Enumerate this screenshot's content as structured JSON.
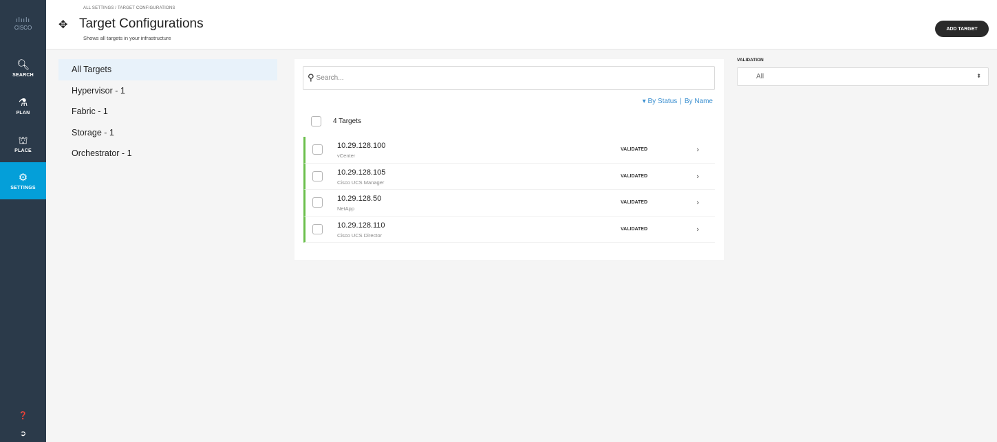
{
  "nav": {
    "logo_bars": "ılıılı",
    "logo_word": "CISCO",
    "items": [
      {
        "label": "SEARCH",
        "icon": "search-icon",
        "glyph": "🔍︎"
      },
      {
        "label": "PLAN",
        "icon": "flask-icon",
        "glyph": "⚗"
      },
      {
        "label": "PLACE",
        "icon": "place-icon",
        "glyph": "⛫"
      },
      {
        "label": "SETTINGS",
        "icon": "gears-icon",
        "glyph": "⚙"
      }
    ],
    "active_item": "SETTINGS",
    "help_glyph": "❓",
    "logout_glyph": "➲",
    "active_color": "#049fd9",
    "rail_color": "#2b3a4a"
  },
  "header": {
    "breadcrumb": "ALL SETTINGS / TARGET CONFIGURATIONS",
    "title_glyph": "✥",
    "title": "Target Configurations",
    "subtitle": "Shows all targets in your infrastructure",
    "add_button": "ADD TARGET"
  },
  "filters": {
    "items": [
      "All Targets",
      "Hypervisor - 1",
      "Fabric - 1",
      "Storage - 1",
      "Orchestrator - 1"
    ],
    "active": "All Targets"
  },
  "search": {
    "icon_glyph": "⚲",
    "placeholder": "Search..."
  },
  "sort": {
    "by_status": "▾ By Status",
    "separator": "|",
    "by_name": "By Name"
  },
  "list": {
    "count_label": "4 Targets",
    "rows": [
      {
        "ip": "10.29.128.100",
        "type": "vCenter",
        "status": "VALIDATED"
      },
      {
        "ip": "10.29.128.105",
        "type": "Cisco UCS Manager",
        "status": "VALIDATED"
      },
      {
        "ip": "10.29.128.50",
        "type": "NetApp",
        "status": "VALIDATED"
      },
      {
        "ip": "10.29.128.110",
        "type": "Cisco UCS Director",
        "status": "VALIDATED"
      }
    ],
    "chevron": "›",
    "status_color": "#6abf4b"
  },
  "validation": {
    "label": "VALIDATION",
    "selected": "All",
    "caret": "⬍"
  }
}
